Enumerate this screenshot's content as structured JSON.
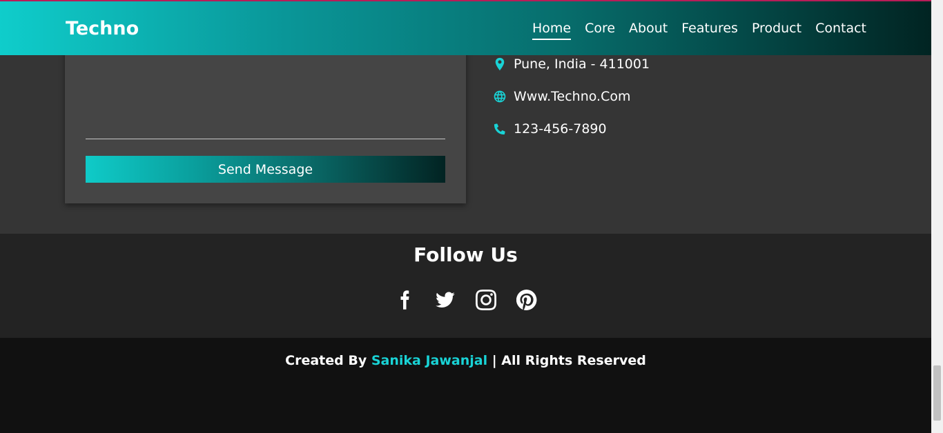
{
  "header": {
    "logo": "Techno",
    "nav": [
      "Home",
      "Core",
      "About",
      "Features",
      "Product",
      "Contact"
    ],
    "active": "Home"
  },
  "contact": {
    "send_label": "Send Message",
    "info": [
      {
        "icon": "map-pin-icon",
        "text": "Pune, India - 411001"
      },
      {
        "icon": "globe-icon",
        "text": "Www.Techno.Com"
      },
      {
        "icon": "phone-icon",
        "text": "123-456-7890"
      }
    ]
  },
  "follow": {
    "title": "Follow Us",
    "socials": [
      "facebook-icon",
      "twitter-icon",
      "instagram-icon",
      "pinterest-icon"
    ]
  },
  "footer": {
    "prefix": "Created By",
    "author": "Sanika Jawanjal",
    "suffix": "| All Rights Reserved"
  },
  "colors": {
    "accent": "#19d3d6",
    "header_start": "#0fcdcb",
    "header_end": "#012422",
    "contact_bg": "#353535",
    "follow_bg": "#232323",
    "footer_bg": "#111111"
  }
}
